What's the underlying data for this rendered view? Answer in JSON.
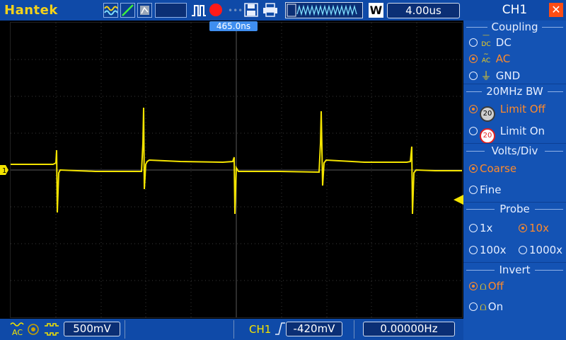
{
  "brand": "Hantek",
  "toolbar": {
    "icons": [
      "waveform-generator-icon",
      "line-icon",
      "memory-icon",
      "blank-icon",
      "pulse-icon",
      "record-icon",
      "dot-icon",
      "save-icon",
      "print-icon"
    ],
    "timebase": "4.00us",
    "w_label": "W"
  },
  "cursor_time": "465.0ns",
  "bottom": {
    "coupling_icon": "AC",
    "volts_div": "500mV",
    "trigger_channel": "CH1",
    "trigger_level": "-420mV",
    "frequency": "0.00000Hz"
  },
  "panel": {
    "title": "CH1",
    "coupling": {
      "label": "Coupling",
      "options": [
        {
          "label": "DC",
          "icon": "dc-icon",
          "selected": false
        },
        {
          "label": "AC",
          "icon": "ac-icon",
          "selected": true
        },
        {
          "label": "GND",
          "icon": "ground-icon",
          "selected": false
        }
      ]
    },
    "bw": {
      "label": "20MHz BW",
      "options": [
        {
          "label": "Limit Off",
          "selected": true
        },
        {
          "label": "Limit On",
          "selected": false
        }
      ]
    },
    "volts": {
      "label": "Volts/Div",
      "options": [
        {
          "label": "Coarse",
          "selected": true
        },
        {
          "label": "Fine",
          "selected": false
        }
      ]
    },
    "probe": {
      "label": "Probe",
      "options": [
        {
          "label": "1x",
          "selected": false
        },
        {
          "label": "10x",
          "selected": true
        },
        {
          "label": "100x",
          "selected": false
        },
        {
          "label": "1000x",
          "selected": false
        }
      ]
    },
    "invert": {
      "label": "Invert",
      "options": [
        {
          "label": "Off",
          "selected": true
        },
        {
          "label": "On",
          "selected": false
        }
      ]
    }
  },
  "channel_marker": "1",
  "colors": {
    "trace": "#f4e400",
    "accent": "#ff8a2b",
    "panel": "#1453b4"
  }
}
